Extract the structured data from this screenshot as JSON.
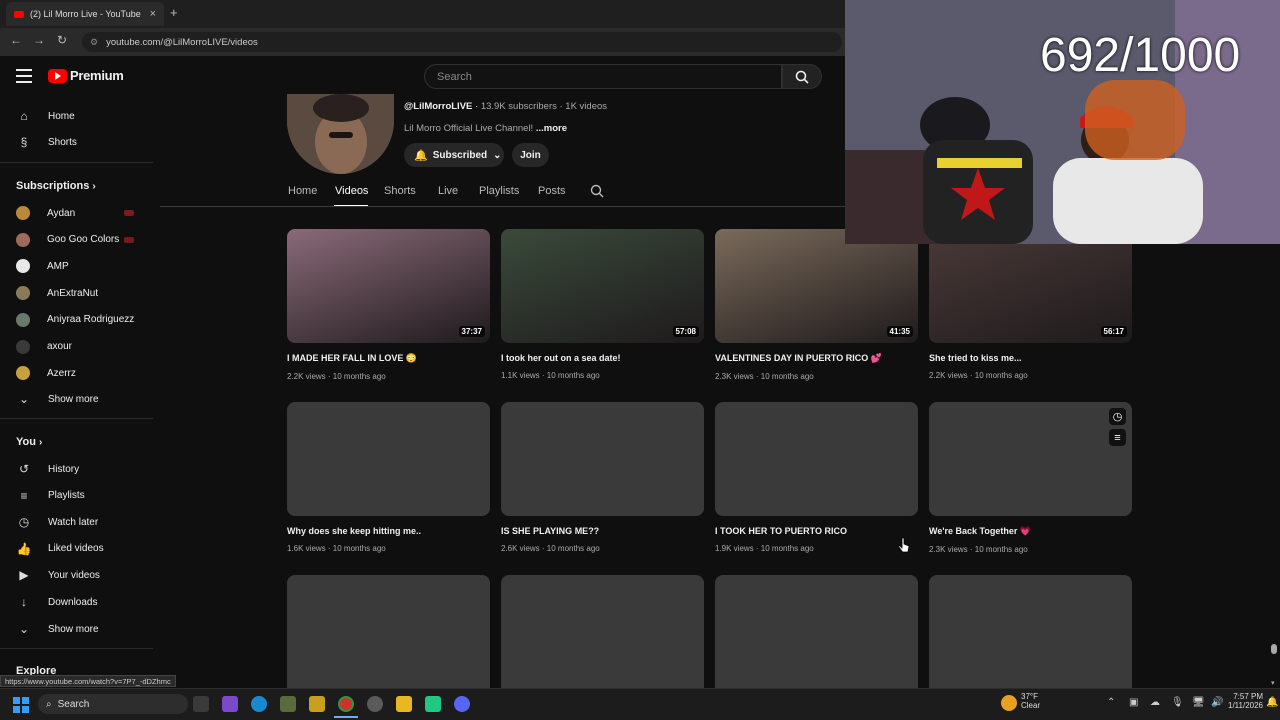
{
  "browser": {
    "tab_title": "(2) Lil Morro Live - YouTube",
    "tab_close": "×",
    "new_tab": "+",
    "url": "youtube.com/@LilMorroLIVE/videos",
    "status_url": "https://www.youtube.com/watch?v=7P7_-dDZhmc"
  },
  "header": {
    "logo_text": "Premium",
    "search_placeholder": "Search"
  },
  "sidebar": {
    "main": [
      {
        "label": "Home",
        "icon": "home-icon",
        "glyph": "⌂"
      },
      {
        "label": "Shorts",
        "icon": "shorts-icon",
        "glyph": "§"
      }
    ],
    "subscriptions_title": "Subscriptions",
    "subscriptions": [
      {
        "label": "Aydan",
        "color": "#b88a3a",
        "live": true
      },
      {
        "label": "Goo Goo Colors",
        "color": "#a06a5a",
        "live": true
      },
      {
        "label": "AMP",
        "color": "#e8e8e8",
        "live": false
      },
      {
        "label": "AnExtraNut",
        "color": "#8a7a5a",
        "live": false
      },
      {
        "label": "Aniyraa Rodriguezz",
        "color": "#6a7a6a",
        "live": false
      },
      {
        "label": "axour",
        "color": "#3a3a3a",
        "live": false
      },
      {
        "label": "Azerrz",
        "color": "#c8a040",
        "live": false
      }
    ],
    "show_more_1": "Show more",
    "you_title": "You",
    "you_items": [
      {
        "label": "History",
        "icon": "history-icon",
        "glyph": "↺"
      },
      {
        "label": "Playlists",
        "icon": "playlists-icon",
        "glyph": "≡"
      },
      {
        "label": "Watch later",
        "icon": "watch-later-icon",
        "glyph": "◷"
      },
      {
        "label": "Liked videos",
        "icon": "like-icon",
        "glyph": "👍"
      },
      {
        "label": "Your videos",
        "icon": "your-videos-icon",
        "glyph": "▶"
      },
      {
        "label": "Downloads",
        "icon": "download-icon",
        "glyph": "↓"
      }
    ],
    "show_more_2": "Show more",
    "explore_title": "Explore"
  },
  "channel": {
    "handle": "@LilMorroLIVE",
    "stats": " · 13.9K subscribers · 1K videos",
    "description": "Lil Morro Official Live Channel!",
    "more": "...more",
    "subscribed_label": "Subscribed",
    "join_label": "Join",
    "tabs": [
      "Home",
      "Videos",
      "Shorts",
      "Live",
      "Playlists",
      "Posts"
    ],
    "active_tab": "Videos"
  },
  "videos": [
    {
      "title": "I MADE HER FALL IN LOVE 😳",
      "meta": "2.2K views · 10 months ago",
      "duration": "37:37",
      "thumb": "#8a6a78"
    },
    {
      "title": "I took her out on a sea date!",
      "meta": "1.1K views · 10 months ago",
      "duration": "57:08",
      "thumb": "#3a4a3a"
    },
    {
      "title": "VALENTINES DAY IN PUERTO RICO 💕",
      "meta": "2.3K views · 10 months ago",
      "duration": "41:35",
      "thumb": "#7a6a5a"
    },
    {
      "title": "She tried to kiss me...",
      "meta": "2.2K views · 10 months ago",
      "duration": "56:17",
      "thumb": "#4a3a38"
    },
    {
      "title": "Why does she keep hitting me..",
      "meta": "1.6K views · 10 months ago",
      "duration": "",
      "thumb": ""
    },
    {
      "title": "IS SHE PLAYING ME??",
      "meta": "2.6K views · 10 months ago",
      "duration": "",
      "thumb": ""
    },
    {
      "title": "I TOOK HER TO PUERTO RICO",
      "meta": "1.9K views · 10 months ago",
      "duration": "",
      "thumb": ""
    },
    {
      "title": "We're Back Together 💗",
      "meta": "2.3K views · 10 months ago",
      "duration": "",
      "thumb": ""
    }
  ],
  "overlay": {
    "counter": "692/1000"
  },
  "taskbar": {
    "search": "Search",
    "weather_temp": "37°F",
    "weather_desc": "Clear",
    "time": "7:57 PM",
    "date": "1/11/2026"
  }
}
